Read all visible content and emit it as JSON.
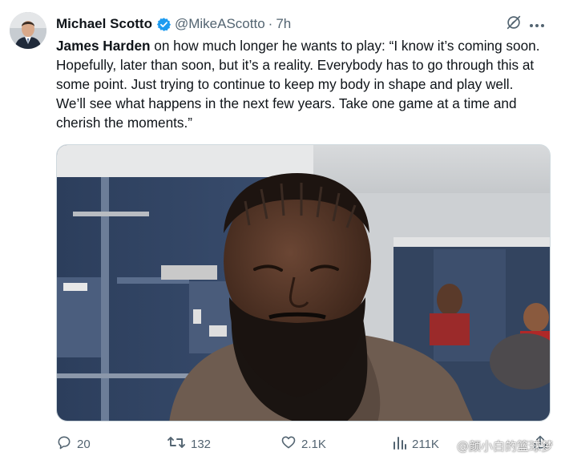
{
  "author": {
    "name": "Michael Scotto",
    "handle": "@MikeAScotto",
    "separator": "·",
    "time": "7h",
    "verified": true
  },
  "tweet": {
    "mention": "James Harden",
    "body": " on how much longer he wants to play: “I know it’s coming soon. Hopefully, later than soon, but it’s a reality. Everybody has to go through this at some point. Just trying to continue to keep my body in shape and play well. We’ll see what happens in the next few years. Take one game at a time and cherish the moments.”"
  },
  "actions": {
    "replies": "20",
    "reposts": "132",
    "likes": "2.1K",
    "views": "211K"
  },
  "watermark": "@颜小白的篮球梦",
  "colors": {
    "verified": "#1d9bf0",
    "muted": "#536471",
    "text": "#0f1419"
  }
}
